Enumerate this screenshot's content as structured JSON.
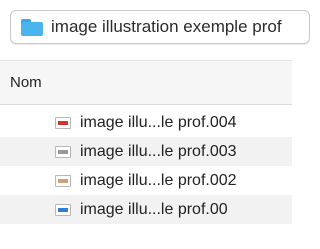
{
  "path_bar": {
    "folder_name": "image illustration exemple prof"
  },
  "header": {
    "column_name": "Nom"
  },
  "files": [
    {
      "name": "image illu...le prof.004",
      "icon": "slide-red-icon",
      "accent": "#d0342c"
    },
    {
      "name": "image illu...le prof.003",
      "icon": "slide-grey-icon",
      "accent": "#9a9a9a"
    },
    {
      "name": "image illu...le prof.002",
      "icon": "slide-photo-icon",
      "accent": "#c9a37a"
    },
    {
      "name": "image illu...le prof.00",
      "icon": "slide-blue-icon",
      "accent": "#2f7fd6"
    }
  ]
}
